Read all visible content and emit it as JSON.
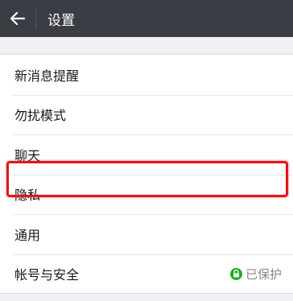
{
  "header": {
    "title": "设置"
  },
  "settings": {
    "items": [
      {
        "label": "新消息提醒"
      },
      {
        "label": "勿扰模式"
      },
      {
        "label": "聊天"
      },
      {
        "label": "隐私"
      },
      {
        "label": "通用"
      },
      {
        "label": "帐号与安全",
        "status": "已保护"
      }
    ]
  },
  "colors": {
    "topbar": "#3a3d43",
    "highlight": "#e0171c",
    "protected_green": "#1aad19"
  },
  "icons": {
    "back": "back-arrow-icon",
    "protected": "lock-icon"
  }
}
